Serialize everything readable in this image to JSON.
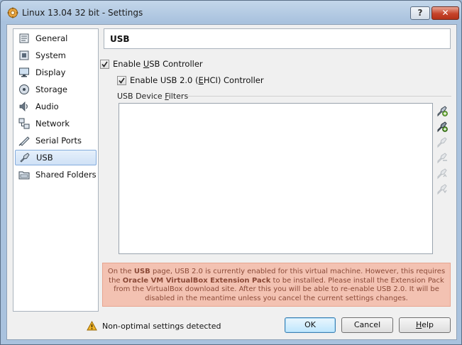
{
  "window": {
    "title": "Linux 13.04 32 bit - Settings",
    "help_button": "?",
    "close_button": "✕"
  },
  "sidebar": {
    "items": [
      {
        "label": "General",
        "icon": "general-icon"
      },
      {
        "label": "System",
        "icon": "system-icon"
      },
      {
        "label": "Display",
        "icon": "display-icon"
      },
      {
        "label": "Storage",
        "icon": "storage-icon"
      },
      {
        "label": "Audio",
        "icon": "audio-icon"
      },
      {
        "label": "Network",
        "icon": "network-icon"
      },
      {
        "label": "Serial Ports",
        "icon": "serial-ports-icon"
      },
      {
        "label": "USB",
        "icon": "usb-icon",
        "selected": true
      },
      {
        "label": "Shared Folders",
        "icon": "shared-folders-icon"
      }
    ]
  },
  "page": {
    "title": "USB",
    "enable_usb": {
      "pre": "Enable ",
      "accel": "U",
      "post": "SB Controller",
      "checked": true
    },
    "enable_usb2": {
      "pre": "Enable USB 2.0 (",
      "accel": "E",
      "post": "HCI) Controller",
      "checked": true
    },
    "filters_label": {
      "pre": "USB Device ",
      "accel": "F",
      "post": "ilters"
    },
    "warning": {
      "p1": "On the ",
      "b1": "USB",
      "p2": " page, USB 2.0 is currently enabled for this virtual machine. However, this requires the ",
      "b2": "Oracle VM VirtualBox Extension Pack",
      "p3": " to be installed. Please install the Extension Pack from the VirtualBox download site. After this you will be able to re-enable USB 2.0. It will be disabled in the meantime unless you cancel the current settings changes."
    }
  },
  "footer": {
    "status": "Non-optimal settings detected",
    "ok": "OK",
    "cancel": "Cancel",
    "help": {
      "accel": "H",
      "post": "elp"
    }
  },
  "colors": {
    "warning_bg": "#f3c2b2",
    "warning_text": "#8b4a38",
    "accent": "#3c7fb1"
  }
}
